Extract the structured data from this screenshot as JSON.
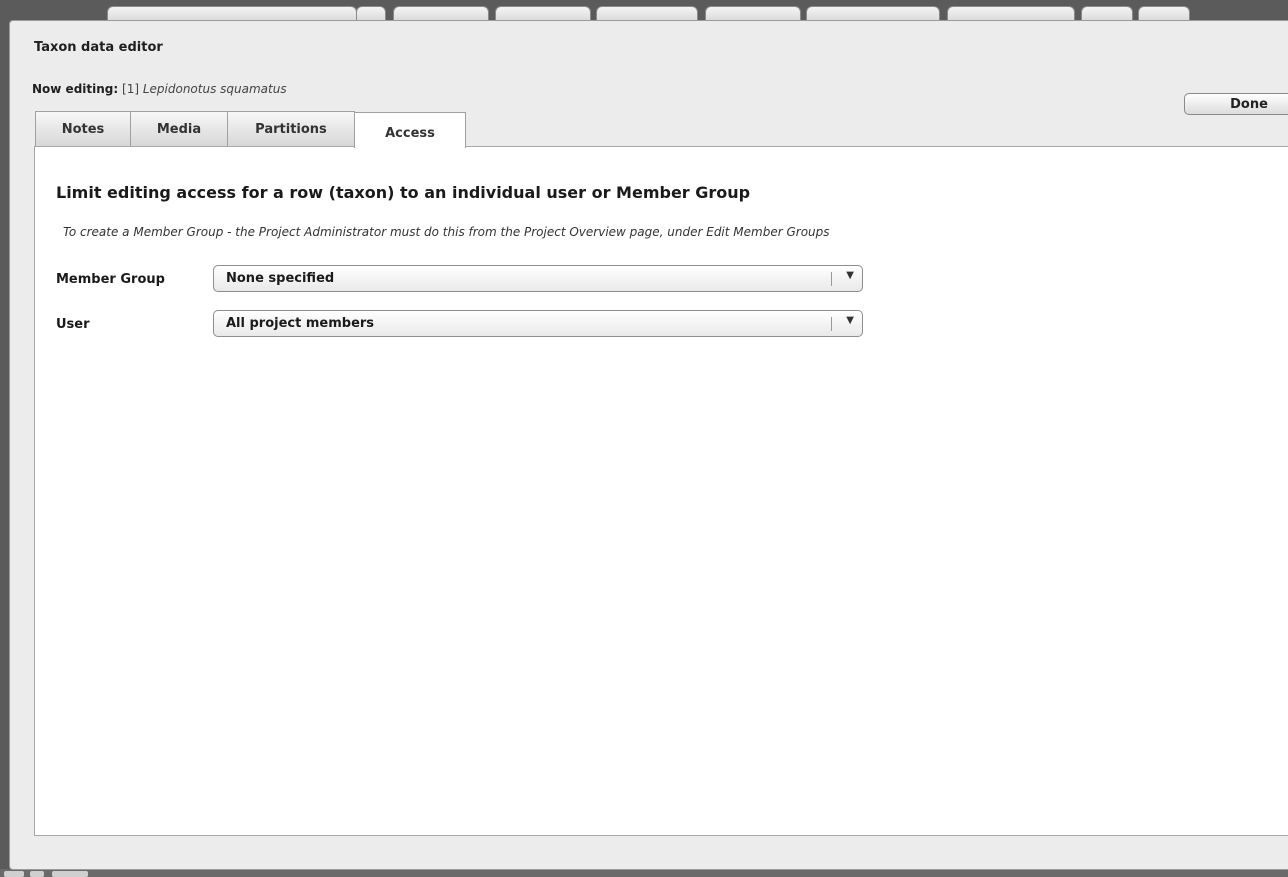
{
  "dialog": {
    "title": "Taxon data editor",
    "editing_label": "Now editing:",
    "editing_index": "[1]",
    "editing_taxon": "Lepidonotus squamatus",
    "done_label": "Done"
  },
  "tabs": [
    {
      "label": "Notes",
      "active": false
    },
    {
      "label": "Media",
      "active": false
    },
    {
      "label": "Partitions",
      "active": false
    },
    {
      "label": "Access",
      "active": true
    }
  ],
  "access": {
    "heading": "Limit editing access for a row (taxon) to an individual user or Member Group",
    "note": "To create a Member Group - the Project Administrator must do this from the Project Overview page, under Edit Member Groups",
    "member_group": {
      "label": "Member Group",
      "value": "None specified"
    },
    "user": {
      "label": "User",
      "value": "All project members"
    }
  },
  "icons": {
    "dropdown": "chevron-down-icon"
  }
}
